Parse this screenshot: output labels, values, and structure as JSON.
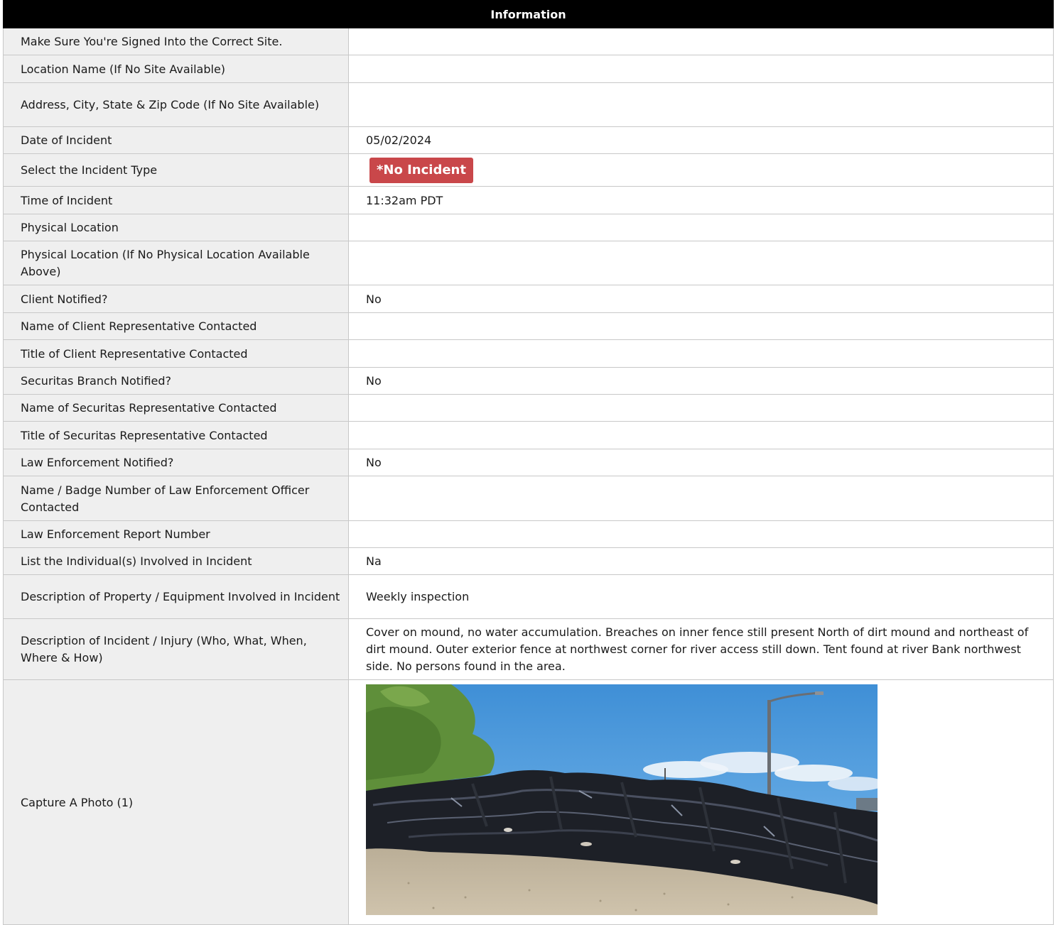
{
  "header": {
    "title": "Information"
  },
  "rows": [
    {
      "label": "Make Sure You're Signed Into the Correct Site.",
      "value": ""
    },
    {
      "label": "Location Name (If No Site Available)",
      "value": ""
    },
    {
      "label": "Address, City, State & Zip Code (If No Site Available)",
      "value": ""
    },
    {
      "label": "Date of Incident",
      "value": "05/02/2024"
    },
    {
      "label": "Select the Incident Type",
      "badge": "*No Incident",
      "badge_color": "#c9474a"
    },
    {
      "label": "Time of Incident",
      "value": "11:32am PDT"
    },
    {
      "label": "Physical Location",
      "value": ""
    },
    {
      "label": "Physical Location (If No Physical Location Available Above)",
      "value": ""
    },
    {
      "label": "Client Notified?",
      "value": "No"
    },
    {
      "label": "Name of Client Representative Contacted",
      "value": ""
    },
    {
      "label": "Title of Client Representative Contacted",
      "value": ""
    },
    {
      "label": "Securitas Branch Notified?",
      "value": "No"
    },
    {
      "label": "Name of Securitas Representative Contacted",
      "value": ""
    },
    {
      "label": "Title of Securitas Representative Contacted",
      "value": ""
    },
    {
      "label": "Law Enforcement Notified?",
      "value": "No"
    },
    {
      "label": "Name / Badge Number of Law Enforcement Officer Contacted",
      "value": ""
    },
    {
      "label": "Law Enforcement Report Number",
      "value": ""
    },
    {
      "label": "List the Individual(s) Involved in Incident",
      "value": "Na"
    },
    {
      "label": "Description of Property / Equipment Involved in Incident",
      "value": "Weekly inspection"
    },
    {
      "label": "Description of Incident / Injury (Who, What, When, Where & How)",
      "value": "Cover on mound, no water accumulation. Breaches on inner fence still present North of dirt mound and northeast of dirt mound. Outer exterior fence at northwest corner for river access still down. Tent found at river Bank northwest side. No persons found in the area."
    },
    {
      "label": "Capture A Photo (1)",
      "photo": "site-photo"
    }
  ]
}
